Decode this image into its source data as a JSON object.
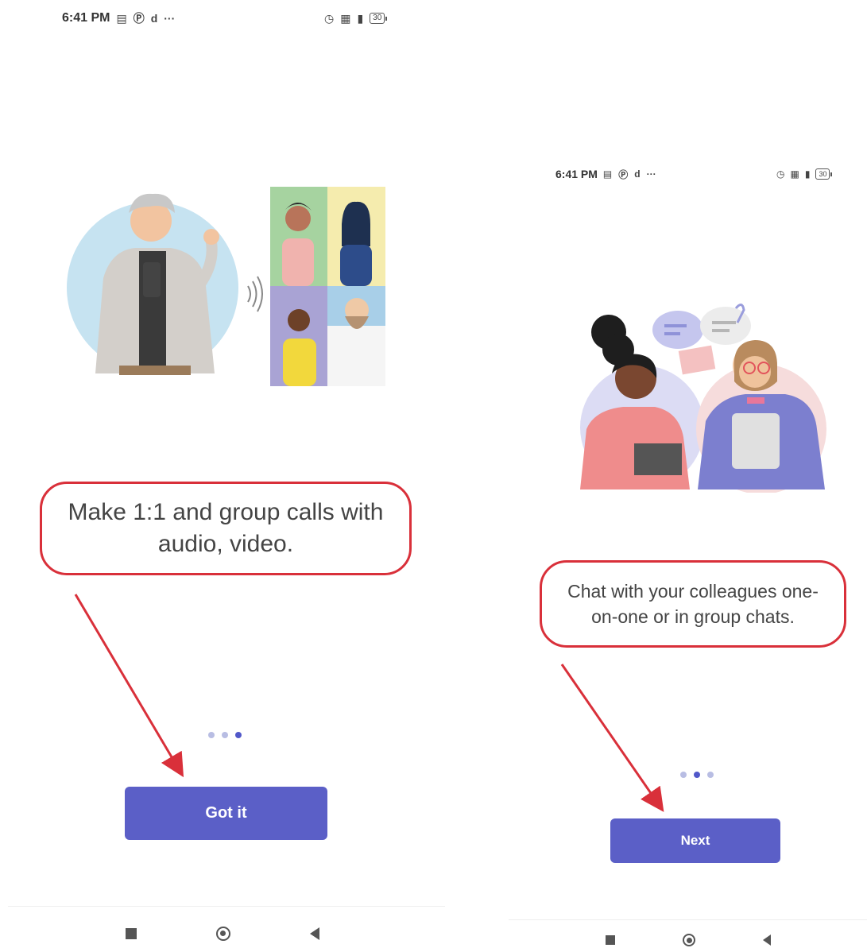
{
  "left_screen": {
    "status_bar": {
      "time": "6:41 PM",
      "battery": "30"
    },
    "caption": "Make 1:1 and group calls with audio, video.",
    "button_label": "Got it"
  },
  "right_screen": {
    "status_bar": {
      "time": "6:41 PM",
      "battery": "30"
    },
    "caption": "Chat with your colleagues one-on-one or in group chats.",
    "button_label": "Next"
  },
  "colors": {
    "accent": "#5b5fc7",
    "annotation_red": "#d9303a",
    "dot_active": "#5158c9",
    "dot_inactive": "#b8bde3"
  }
}
